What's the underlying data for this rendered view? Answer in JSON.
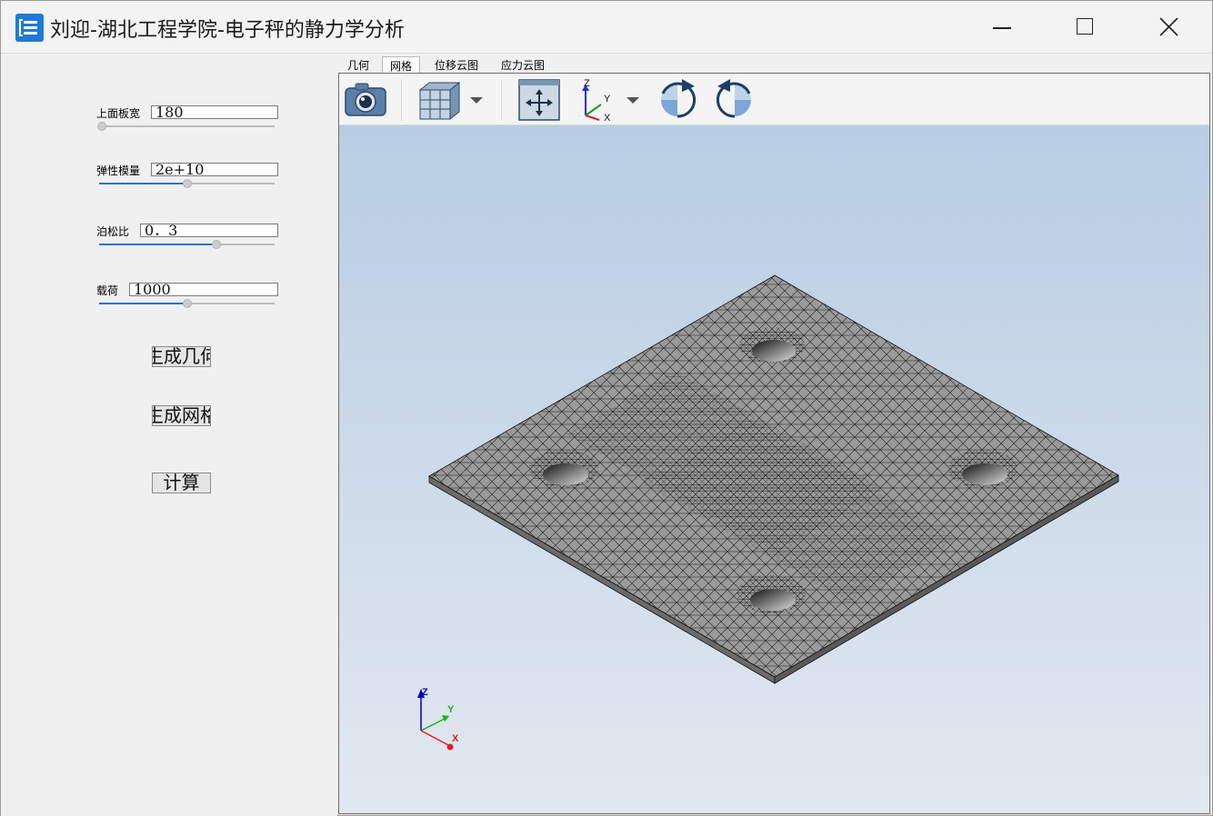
{
  "window": {
    "title": "刘迎-湖北工程学院-电子秤的静力学分析",
    "controls": {
      "minimize": "minimize-icon",
      "maximize": "maximize-icon",
      "close": "close-icon"
    }
  },
  "params": [
    {
      "label": "上面板宽",
      "value": "180",
      "slider_fraction": 0.0
    },
    {
      "label": "弹性模量",
      "value": "2e+10",
      "slider_fraction": 0.5
    },
    {
      "label": "泊松比",
      "value": "0．3",
      "slider_fraction": 0.67
    },
    {
      "label": "载荷",
      "value": "1000",
      "slider_fraction": 0.5
    }
  ],
  "buttons": {
    "generate_geometry": "生成几何",
    "generate_mesh": "生成网格",
    "compute": "计算"
  },
  "tabs": [
    {
      "label": "几何",
      "active": false
    },
    {
      "label": "网格",
      "active": true
    },
    {
      "label": "位移云图",
      "active": false
    },
    {
      "label": "应力云图",
      "active": false
    }
  ],
  "toolbar": {
    "icons": [
      "camera-icon",
      "display-mode-icon",
      "fit-all-icon",
      "axes-orientation-icon",
      "rotate-clockwise-icon",
      "rotate-counterclockwise-icon"
    ]
  },
  "axis_triad": {
    "x": "X",
    "y": "Y",
    "z": "Z"
  },
  "colors": {
    "accent": "#2e6fd6",
    "app_icon": "#1f7ad8",
    "mesh_fill": "#9a9a9a"
  }
}
